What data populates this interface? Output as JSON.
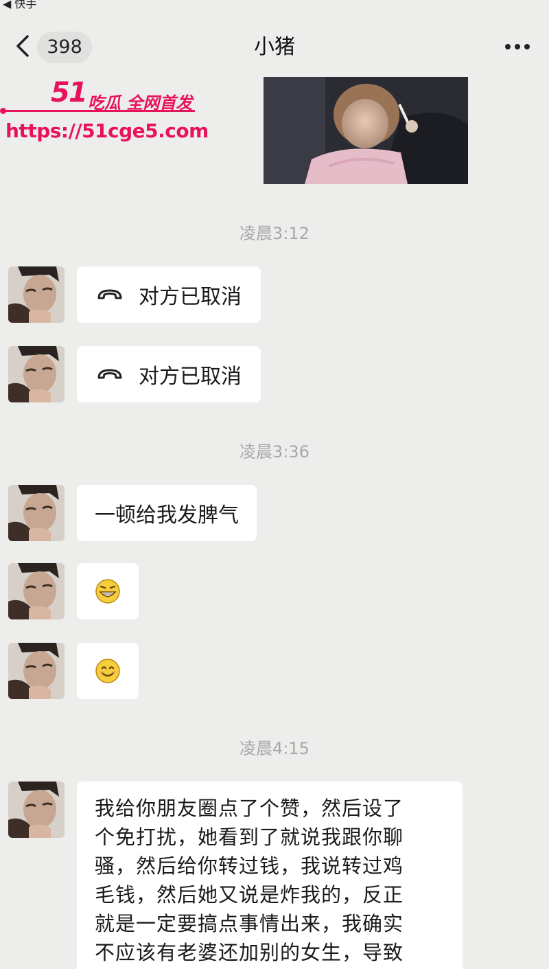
{
  "status_bar": {
    "text": "◀ 快手"
  },
  "header": {
    "back_label": "返回",
    "unread_count": "398",
    "title": "小猪",
    "more_label": "···"
  },
  "watermark": {
    "logo": "51",
    "tagline": "吃瓜 全网首发",
    "url": "https://51cge5.com"
  },
  "messages": {
    "ts1": "凌晨3:12",
    "call1": "对方已取消",
    "call2": "对方已取消",
    "ts2": "凌晨3:36",
    "text1": "一顿给我发脾气",
    "ts3": "凌晨4:15",
    "long_lines": [
      "我给你朋友圈点了个赞，然后设了",
      "个免打扰，她看到了就说我跟你聊",
      "骚，然后给你转过钱，我说转过鸡",
      "毛钱，然后她又说是炸我的，反正",
      "就是一定要搞点事情出来，我确实",
      "不应该有老婆还加别的女生，导致"
    ]
  },
  "icons": {
    "back": "chevron-left-icon",
    "more": "more-dots-icon",
    "call": "hangup-phone-icon",
    "emoji1": "grin-emoji-icon",
    "emoji2": "smile-emoji-icon"
  },
  "colors": {
    "background": "#ededeb",
    "bubble": "#ffffff",
    "watermark": "#e8125c",
    "timestamp": "#a8a8a8"
  }
}
